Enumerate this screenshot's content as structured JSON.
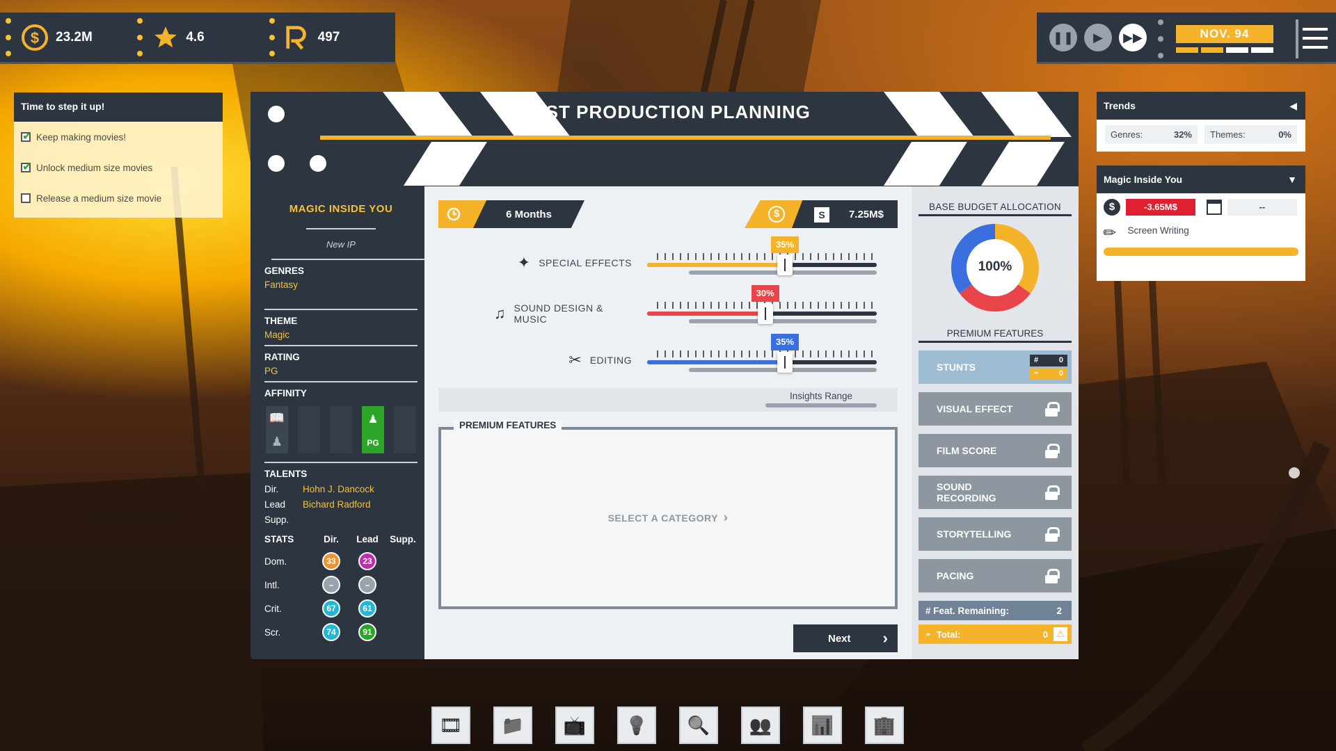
{
  "hud": {
    "money": "23.2M",
    "rating": "4.6",
    "fans": "497",
    "date": "NOV. 94"
  },
  "objectives": {
    "title": "Time to step it up!",
    "items": [
      {
        "label": "Keep making movies!",
        "done": true
      },
      {
        "label": "Unlock medium size movies",
        "done": true
      },
      {
        "label": "Release a medium size movie",
        "done": false
      }
    ]
  },
  "header": {
    "title": "POST PRODUCTION PLANNING"
  },
  "movie": {
    "title": "MAGIC INSIDE YOU",
    "ip": "New IP",
    "genres_label": "GENRES",
    "genre": "Fantasy",
    "theme_label": "THEME",
    "theme": "Magic",
    "rating_label": "RATING",
    "rating": "PG",
    "affinity_label": "AFFINITY",
    "affinity_badge": "PG",
    "talents_label": "TALENTS",
    "talents": [
      {
        "role": "Dir.",
        "name": "Hohn J. Dancock"
      },
      {
        "role": "Lead",
        "name": "Bichard Radford"
      },
      {
        "role": "Supp.",
        "name": ""
      }
    ],
    "stats_label": "STATS",
    "stats_cols": [
      "Dir.",
      "Lead",
      "Supp."
    ],
    "stats": [
      {
        "label": "Dom.",
        "dir": "33",
        "lead": "23"
      },
      {
        "label": "Intl.",
        "dir": "–",
        "lead": "–"
      },
      {
        "label": "Crit.",
        "dir": "67",
        "lead": "61"
      },
      {
        "label": "Scr.",
        "dir": "74",
        "lead": "91"
      }
    ]
  },
  "planning": {
    "duration": "6 Months",
    "currency_symbol": "$",
    "budget": "7.25M$",
    "sliders": [
      {
        "label": "SPECIAL EFFECTS",
        "value": 35,
        "pct_text": "35%",
        "color": "#f5b32a",
        "icon": "magic-wand-icon"
      },
      {
        "label": "SOUND DESIGN & MUSIC",
        "value": 30,
        "pct_text": "30%",
        "color": "#e8454a",
        "icon": "music-note-icon"
      },
      {
        "label": "EDITING",
        "value": 35,
        "pct_text": "35%",
        "color": "#3b6fe0",
        "icon": "scissors-icon"
      }
    ],
    "insights_label": "Insights Range",
    "premium_features_label": "PREMIUM FEATURES",
    "select_category": "SELECT A CATEGORY",
    "next_label": "Next"
  },
  "budget_allocation": {
    "title": "BASE BUDGET ALLOCATION",
    "total_pct": "100%",
    "slices": [
      {
        "name": "Special Effects",
        "value": 35,
        "color": "#f5b32a"
      },
      {
        "name": "Sound Design & Music",
        "value": 30,
        "color": "#e8454a"
      },
      {
        "name": "Editing",
        "value": 35,
        "color": "#3b6fe0"
      }
    ],
    "premium_title": "PREMIUM FEATURES",
    "features": [
      {
        "label": "STUNTS",
        "locked": false,
        "count": "0",
        "fans": "0"
      },
      {
        "label": "VISUAL EFFECT",
        "locked": true
      },
      {
        "label": "FILM SCORE",
        "locked": true
      },
      {
        "label": "SOUND RECORDING",
        "locked": true
      },
      {
        "label": "STORYTELLING",
        "locked": true
      },
      {
        "label": "PACING",
        "locked": true
      }
    ],
    "remaining_label": "# Feat. Remaining:",
    "remaining_value": "2",
    "total_label": "Total:",
    "total_value": "0"
  },
  "trends": {
    "title": "Trends",
    "genres_label": "Genres:",
    "genres_value": "32%",
    "themes_label": "Themes:",
    "themes_value": "0%"
  },
  "project_card": {
    "title": "Magic Inside You",
    "money": "-3.65M$",
    "date": "--",
    "task": "Screen Writing",
    "progress": 1.0
  },
  "bottom_bar": [
    {
      "icon": "film-reel-icon",
      "glyph": "🎞"
    },
    {
      "icon": "folder-icon",
      "glyph": "📁"
    },
    {
      "icon": "tv-icon",
      "glyph": "📺"
    },
    {
      "icon": "lightbulb-icon",
      "glyph": "💡"
    },
    {
      "icon": "magnifier-icon",
      "glyph": "🔍"
    },
    {
      "icon": "people-icon",
      "glyph": "👥"
    },
    {
      "icon": "chart-icon",
      "glyph": "📊"
    },
    {
      "icon": "building-icon",
      "glyph": "🏢"
    }
  ]
}
